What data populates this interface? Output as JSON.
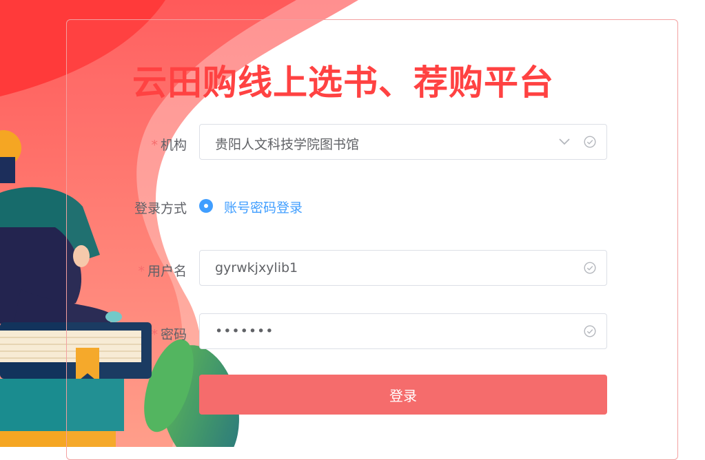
{
  "title": "云田购线上选书、荐购平台",
  "form": {
    "org": {
      "label": "机构",
      "required_mark": "*",
      "value": "贵阳人文科技学院图书馆"
    },
    "login_mode": {
      "label": "登录方式",
      "option_label": "账号密码登录",
      "selected": true
    },
    "username": {
      "label": "用户名",
      "required_mark": "*",
      "value": "gyrwkjxylib1"
    },
    "password": {
      "label": "密码",
      "required_mark": "*",
      "masked_value": "•••••••"
    },
    "submit_label": "登录"
  },
  "colors": {
    "accent": "#ff4242",
    "button": "#f56c6c",
    "link": "#409eff"
  },
  "icons": [
    "chevron-down-icon",
    "check-circle-icon"
  ]
}
